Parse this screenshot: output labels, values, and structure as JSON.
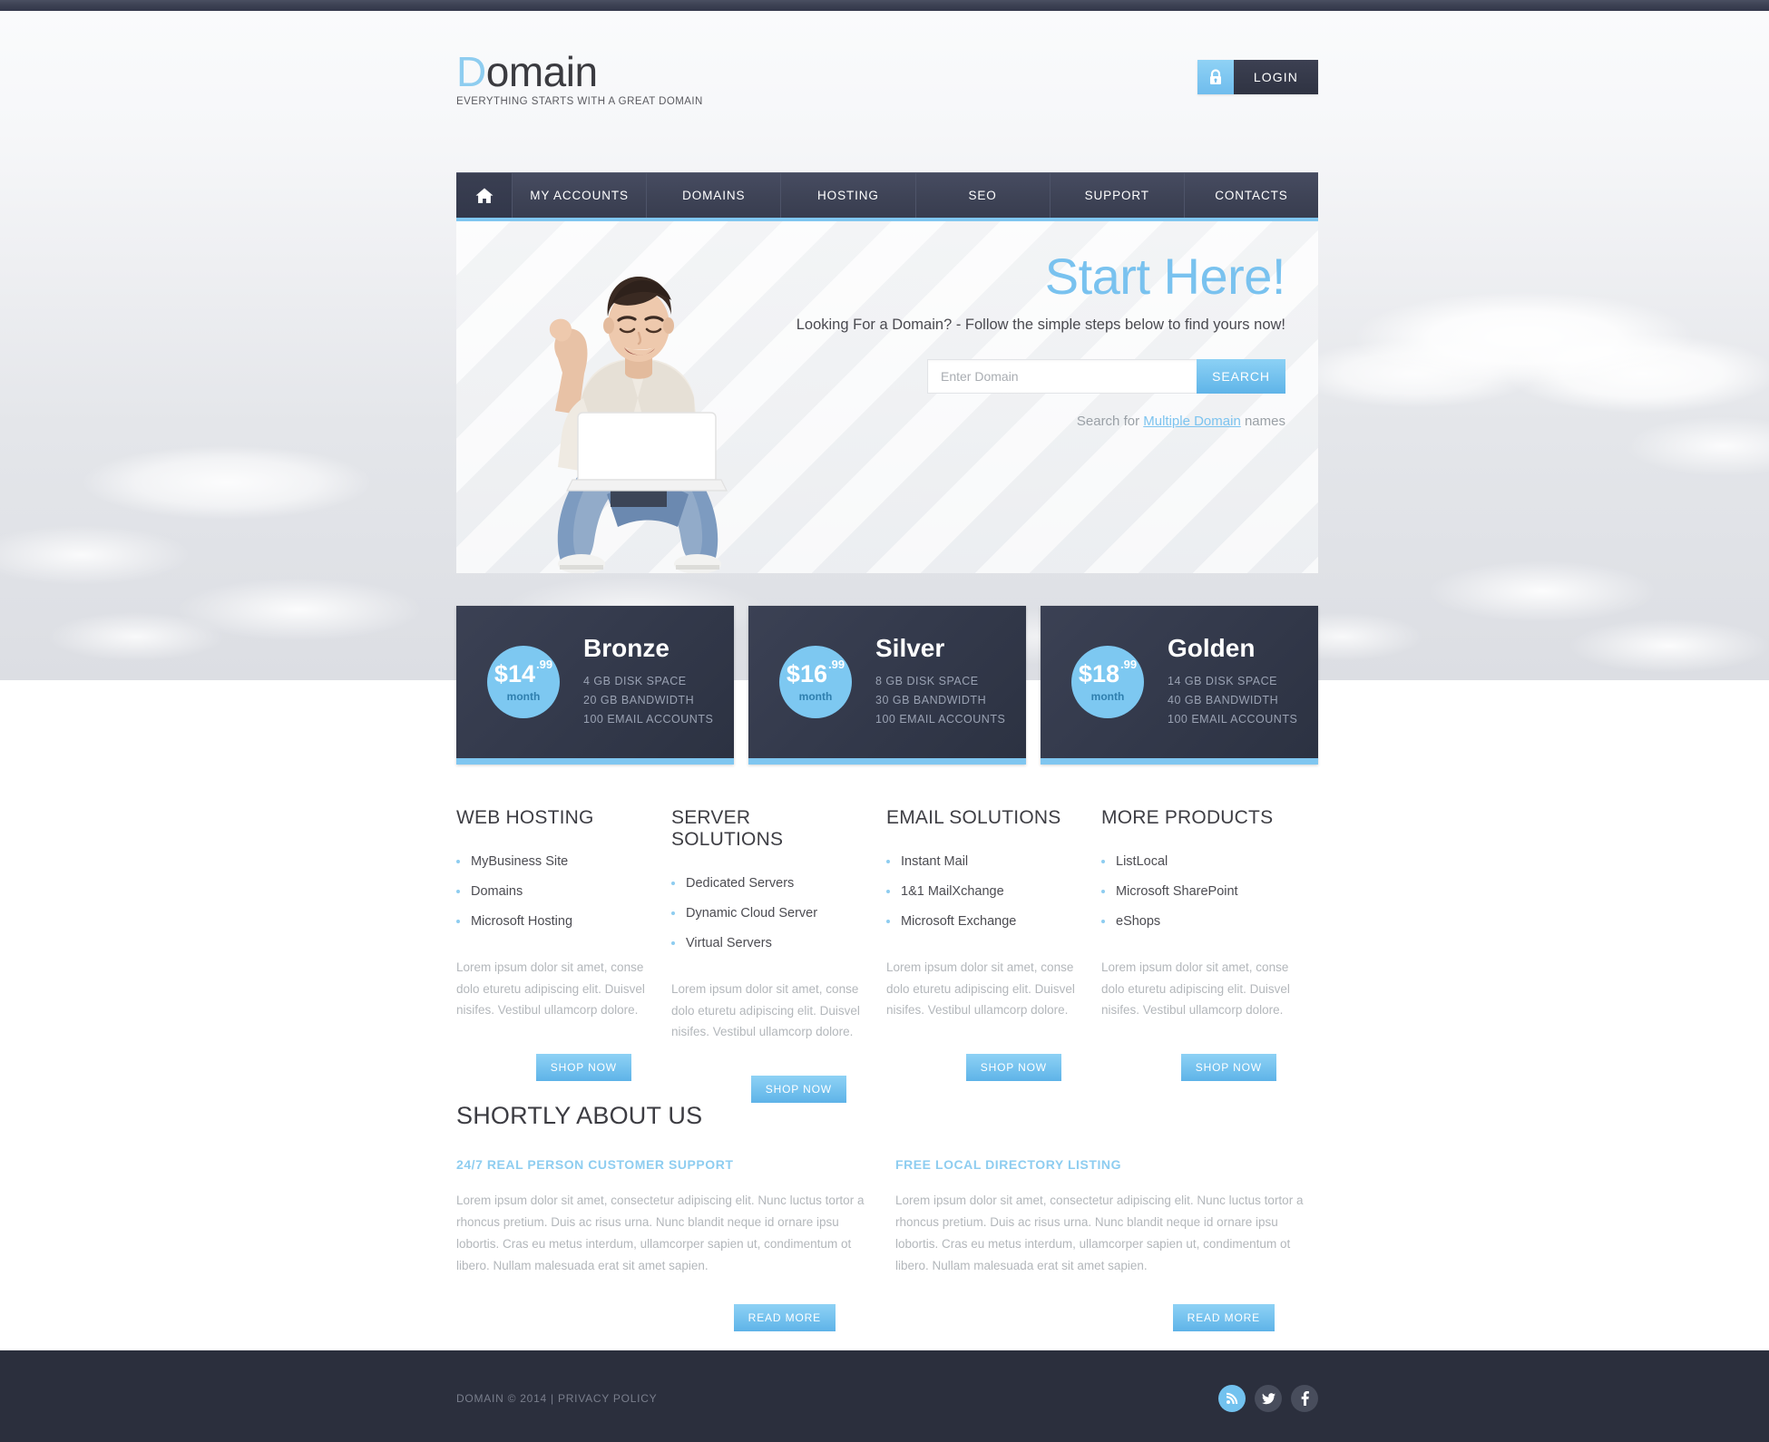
{
  "header": {
    "logo_accent": "D",
    "logo_rest": "omain",
    "tagline": "EVERYTHING STARTS WITH A GREAT DOMAIN",
    "login_label": "LOGIN",
    "lock_icon": "lock-icon"
  },
  "nav": {
    "home_icon": "home-icon",
    "items": [
      {
        "label": "MY ACCOUNTS"
      },
      {
        "label": "DOMAINS"
      },
      {
        "label": "HOSTING"
      },
      {
        "label": "SEO"
      },
      {
        "label": "SUPPORT"
      },
      {
        "label": "CONTACTS"
      }
    ]
  },
  "hero": {
    "title": "Start Here!",
    "subtitle": "Looking For a Domain? - Follow the simple steps below to find yours now!",
    "search_placeholder": "Enter Domain",
    "search_value": "",
    "search_button": "SEARCH",
    "note_prefix": "Search for ",
    "note_link": "Multiple Domain",
    "note_suffix": " names",
    "photo_alt": "man-with-laptop-photo"
  },
  "pricing": {
    "plans": [
      {
        "name": "Bronze",
        "price": "$14",
        "cents": ".99",
        "period": "month",
        "features": [
          "4 GB DISK SPACE",
          "20 GB BANDWIDTH",
          "100 EMAIL ACCOUNTS"
        ]
      },
      {
        "name": "Silver",
        "price": "$16",
        "cents": ".99",
        "period": "month",
        "features": [
          "8 GB DISK SPACE",
          "30 GB BANDWIDTH",
          "100 EMAIL ACCOUNTS"
        ]
      },
      {
        "name": "Golden",
        "price": "$18",
        "cents": ".99",
        "period": "month",
        "features": [
          "14 GB DISK SPACE",
          "40 GB BANDWIDTH",
          "100 EMAIL ACCOUNTS"
        ]
      }
    ]
  },
  "products": {
    "shop_label": "SHOP NOW",
    "columns": [
      {
        "title": "WEB HOSTING",
        "items": [
          "MyBusiness Site",
          "Domains",
          "Microsoft Hosting"
        ],
        "description": "Lorem ipsum dolor sit amet, conse dolo eturetu adipiscing elit. Duisvel nisifes. Vestibul ullamcorp dolore."
      },
      {
        "title": "SERVER SOLUTIONS",
        "items": [
          "Dedicated Servers",
          "Dynamic Cloud Server",
          "Virtual Servers"
        ],
        "description": "Lorem ipsum dolor sit amet, conse dolo eturetu adipiscing elit. Duisvel nisifes. Vestibul ullamcorp dolore."
      },
      {
        "title": "EMAIL SOLUTIONS",
        "items": [
          "Instant Mail",
          "1&1 MailXchange",
          "Microsoft Exchange"
        ],
        "description": "Lorem ipsum dolor sit amet, conse dolo eturetu adipiscing elit. Duisvel nisifes. Vestibul ullamcorp dolore."
      },
      {
        "title": "MORE PRODUCTS",
        "items": [
          "ListLocal",
          "Microsoft SharePoint",
          "eShops"
        ],
        "description": "Lorem ipsum dolor sit amet, conse dolo eturetu adipiscing elit. Duisvel nisifes. Vestibul ullamcorp dolore."
      }
    ]
  },
  "about": {
    "title": "SHORTLY ABOUT US",
    "read_more_label": "READ MORE",
    "columns": [
      {
        "subtitle": "24/7 REAL PERSON CUSTOMER SUPPORT",
        "text": "Lorem ipsum dolor sit amet, consectetur adipiscing elit. Nunc luctus tortor a rhoncus pretium. Duis ac risus urna. Nunc blandit neque id ornare ipsu lobortis. Cras eu metus interdum, ullamcorper sapien ut, condimentum ot libero. Nullam malesuada erat sit amet sapien."
      },
      {
        "subtitle": "FREE LOCAL DIRECTORY LISTING",
        "text": "Lorem ipsum dolor sit amet, consectetur adipiscing elit. Nunc luctus tortor a rhoncus pretium. Duis ac risus urna. Nunc blandit neque id ornare ipsu lobortis. Cras eu metus interdum, ullamcorper sapien ut, condimentum ot libero. Nullam malesuada erat sit amet sapien."
      }
    ]
  },
  "footer": {
    "copyright": "DOMAIN © 2014 | PRIVACY POLICY",
    "social": [
      {
        "name": "rss-icon"
      },
      {
        "name": "twitter-icon"
      },
      {
        "name": "facebook-icon"
      }
    ]
  },
  "colors": {
    "accent_blue": "#7fc6f0",
    "dark_navy": "#383d4f",
    "footer_bg": "#2b2f3d",
    "muted_text": "#b3b7bb"
  }
}
